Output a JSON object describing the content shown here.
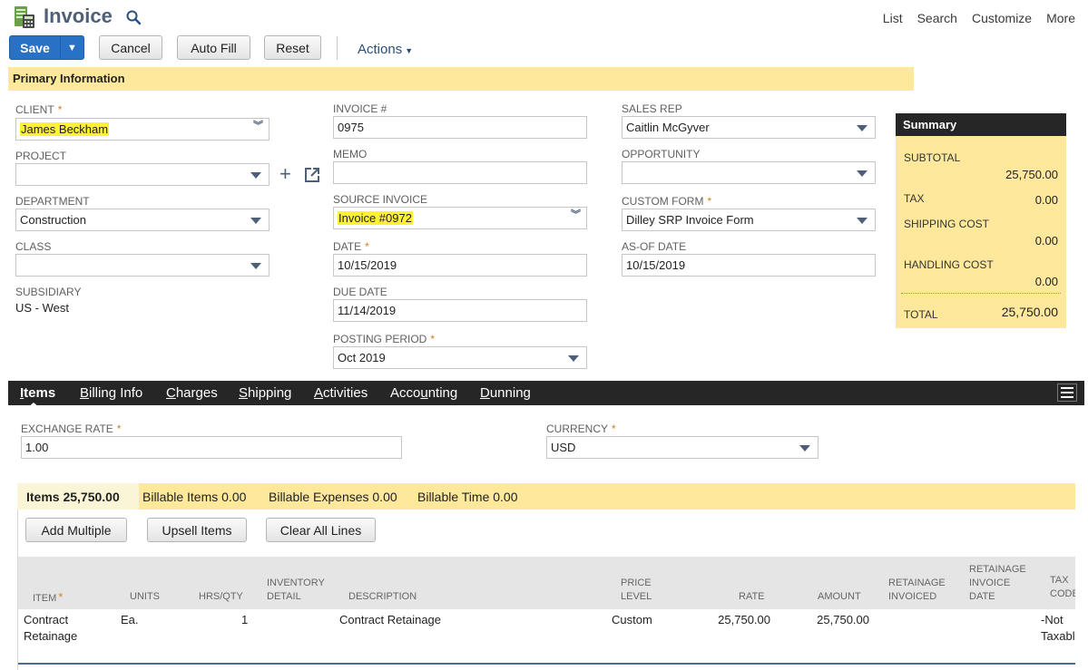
{
  "header": {
    "title": "Invoice",
    "links": [
      "List",
      "Search",
      "Customize",
      "More"
    ]
  },
  "toolbar": {
    "save": "Save",
    "cancel": "Cancel",
    "autofill": "Auto Fill",
    "reset": "Reset",
    "actions": "Actions"
  },
  "section": {
    "title": "Primary Information"
  },
  "col1": {
    "client_label": "CLIENT",
    "client_value": "James Beckham",
    "project_label": "PROJECT",
    "project_value": "",
    "department_label": "DEPARTMENT",
    "department_value": "Construction",
    "class_label": "CLASS",
    "class_value": "",
    "subsidiary_label": "SUBSIDIARY",
    "subsidiary_value": "US - West"
  },
  "col2": {
    "invoice_label": "INVOICE #",
    "invoice_value": "0975",
    "memo_label": "MEMO",
    "memo_value": "",
    "source_label": "SOURCE INVOICE",
    "source_value": "Invoice #0972",
    "date_label": "DATE",
    "date_value": "10/15/2019",
    "due_label": "DUE DATE",
    "due_value": "11/14/2019",
    "posting_label": "POSTING PERIOD",
    "posting_value": "Oct 2019"
  },
  "col3": {
    "salesrep_label": "SALES REP",
    "salesrep_value": "Caitlin McGyver",
    "opportunity_label": "OPPORTUNITY",
    "opportunity_value": "",
    "customform_label": "CUSTOM FORM",
    "customform_value": "Dilley SRP Invoice Form",
    "asof_label": "AS-OF DATE",
    "asof_value": "10/15/2019"
  },
  "summary": {
    "title": "Summary",
    "subtotal_label": "SUBTOTAL",
    "subtotal_value": "25,750.00",
    "tax_label": "TAX",
    "tax_value": "0.00",
    "shipping_label": "SHIPPING COST",
    "shipping_value": "0.00",
    "handling_label": "HANDLING COST",
    "handling_value": "0.00",
    "total_label": "TOTAL",
    "total_value": "25,750.00"
  },
  "tabs": [
    {
      "label": "Items",
      "u": "I",
      "rest": "tems"
    },
    {
      "label": "Billing Info",
      "u": "B",
      "rest": "illing Info"
    },
    {
      "label": "Charges",
      "u": "C",
      "rest": "harges"
    },
    {
      "label": "Shipping",
      "u": "S",
      "rest": "hipping"
    },
    {
      "label": "Activities",
      "u": "A",
      "rest": "ctivities"
    },
    {
      "label": "Accounting",
      "pre": "Acco",
      "u": "u",
      "rest": "nting"
    },
    {
      "label": "Dunning",
      "u": "D",
      "rest": "unning"
    }
  ],
  "items_tab": {
    "exchange_label": "EXCHANGE RATE",
    "exchange_value": "1.00",
    "currency_label": "CURRENCY",
    "currency_value": "USD"
  },
  "subtabs": {
    "items": "Items 25,750.00",
    "billable_items": "Billable Items 0.00",
    "billable_expenses": "Billable Expenses 0.00",
    "billable_time": "Billable Time 0.00"
  },
  "item_buttons": {
    "add_multiple": "Add Multiple",
    "upsell": "Upsell Items",
    "clear_all": "Clear All Lines"
  },
  "table": {
    "headers": {
      "item": "ITEM",
      "units": "UNITS",
      "hrsqty": "HRS/QTY",
      "inventory_1": "INVENTORY",
      "inventory_2": "DETAIL",
      "description": "DESCRIPTION",
      "price_1": "PRICE",
      "price_2": "LEVEL",
      "rate": "RATE",
      "amount": "AMOUNT",
      "ret_inv_1": "RETAINAGE",
      "ret_inv_2": "INVOICED",
      "ret_date_1": "RETAINAGE",
      "ret_date_2": "INVOICE",
      "ret_date_3": "DATE",
      "tax_1": "TAX",
      "tax_2": "CODE"
    },
    "row": {
      "item_1": "Contract",
      "item_2": "Retainage",
      "units": "Ea.",
      "qty": "1",
      "description": "Contract Retainage",
      "price_level": "Custom",
      "rate": "25,750.00",
      "amount": "25,750.00",
      "tax_1": "-Not",
      "tax_2": "Taxable"
    }
  }
}
